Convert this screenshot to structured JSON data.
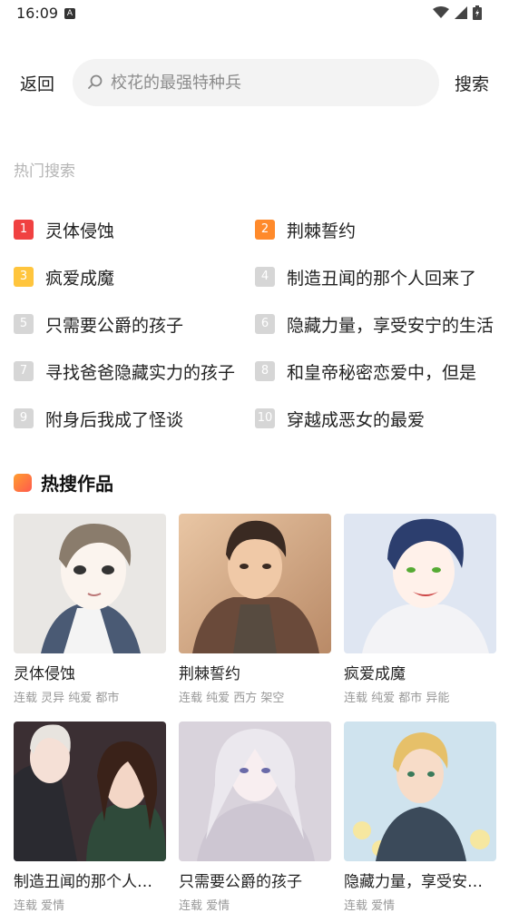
{
  "status_bar": {
    "time": "16:09",
    "a_icon": "A"
  },
  "search": {
    "back_label": "返回",
    "placeholder": "校花的最强特种兵",
    "submit_label": "搜索"
  },
  "hot_search": {
    "title": "热门搜索",
    "items": [
      {
        "rank": "1",
        "text": "灵体侵蚀",
        "color": "#f04141"
      },
      {
        "rank": "2",
        "text": "荆棘誓约",
        "color": "#ff8a2b"
      },
      {
        "rank": "3",
        "text": "疯爱成魔",
        "color": "#ffc53d"
      },
      {
        "rank": "4",
        "text": "制造丑闻的那个人回来了",
        "color": "#d6d6d6"
      },
      {
        "rank": "5",
        "text": "只需要公爵的孩子",
        "color": "#d6d6d6"
      },
      {
        "rank": "6",
        "text": "隐藏力量，享受安宁的生活",
        "color": "#d6d6d6"
      },
      {
        "rank": "7",
        "text": "寻找爸爸隐藏实力的孩子",
        "color": "#d6d6d6"
      },
      {
        "rank": "8",
        "text": "和皇帝秘密恋爱中，但是",
        "color": "#d6d6d6"
      },
      {
        "rank": "9",
        "text": "附身后我成了怪谈",
        "color": "#d6d6d6"
      },
      {
        "rank": "10",
        "text": "穿越成恶女的最爱",
        "color": "#d6d6d6"
      }
    ]
  },
  "hot_works": {
    "title": "热搜作品",
    "cards": [
      {
        "title": "灵体侵蚀",
        "tags": "连载 灵异 纯爱 都市"
      },
      {
        "title": "荆棘誓约",
        "tags": "连载 纯爱 西方 架空"
      },
      {
        "title": "疯爱成魔",
        "tags": "连载 纯爱 都市 异能"
      },
      {
        "title": "制造丑闻的那个人回来了",
        "tags": "连载 爱情"
      },
      {
        "title": "只需要公爵的孩子",
        "tags": "连载 爱情"
      },
      {
        "title": "隐藏力量，享受安宁的生活",
        "tags": "连载 爱情"
      }
    ]
  }
}
